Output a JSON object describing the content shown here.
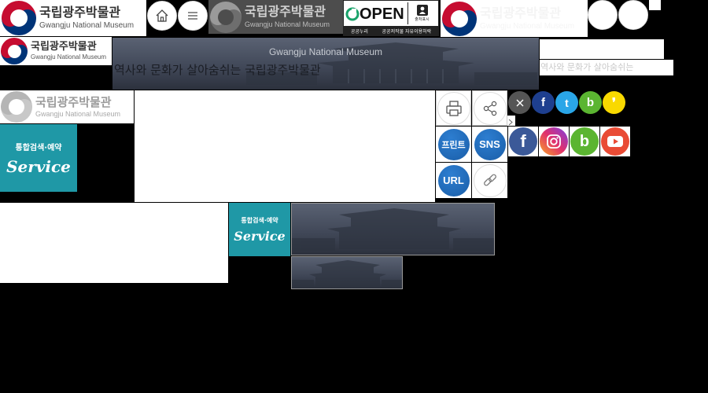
{
  "museum": {
    "name_ko": "국립광주박물관",
    "name_en": "Gwangju National Museum"
  },
  "license": {
    "open_label": "OPEN",
    "badge_label": "출처표시",
    "caption_left": "공공누리",
    "caption_right": "공공저작물 자유이용허락"
  },
  "banner": {
    "title_en": "Gwangju National Museum",
    "slogan": "역사와 문화가 살아숨쉬는 국립광주박물관",
    "slogan_short": "역사와 문화가 살아숨쉬는"
  },
  "share": {
    "print_label": "프린트",
    "sns_label": "SNS",
    "url_label": "URL"
  },
  "service": {
    "line1": "통합검색·예약",
    "line2": "Service"
  },
  "icons": {
    "home": "home-icon",
    "menu": "menu-icon",
    "print": "printer-icon",
    "share": "share-icon",
    "close": "close-icon",
    "facebook": "facebook-icon",
    "twitter": "twitter-icon",
    "blog": "blog-icon",
    "kakao": "kakaostory-icon",
    "instagram": "instagram-icon",
    "youtube": "youtube-icon",
    "link": "link-icon"
  },
  "colors": {
    "taegeuk_red": "#c60c30",
    "taegeuk_blue": "#003478",
    "facebook": "#3b5998",
    "twitter": "#1da1f2",
    "blog": "#5bb531",
    "kakao": "#f9d900",
    "youtube": "#e62117",
    "share_blue": "#1a5ea8",
    "service_teal": "#1f98a6"
  }
}
